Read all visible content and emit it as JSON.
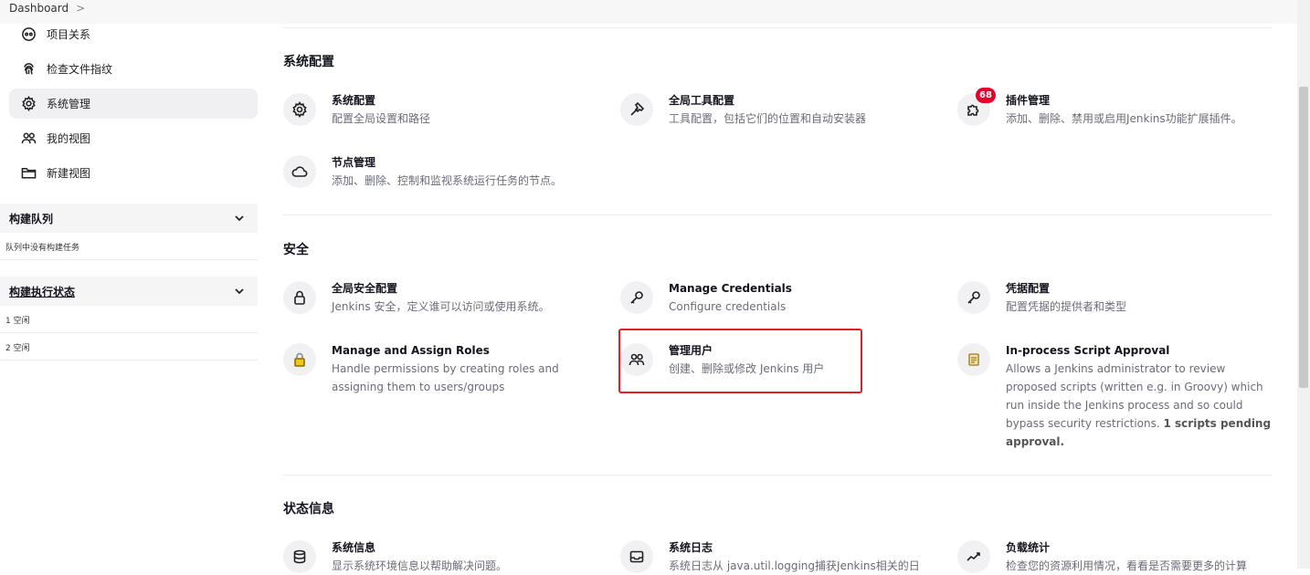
{
  "breadcrumb": {
    "home": "Dashboard",
    "separator": ">"
  },
  "sidebar": {
    "items": [
      {
        "label": "项目关系",
        "icon": "relationship-icon"
      },
      {
        "label": "检查文件指纹",
        "icon": "fingerprint-icon"
      },
      {
        "label": "系统管理",
        "icon": "gear-icon",
        "active": true
      },
      {
        "label": "我的视图",
        "icon": "people-icon"
      },
      {
        "label": "新建视图",
        "icon": "folder-icon"
      }
    ],
    "build_queue": {
      "title": "构建队列",
      "empty_text": "队列中没有构建任务"
    },
    "executors": {
      "title": "构建执行状态",
      "rows": [
        "1  空闲",
        "2  空闲"
      ]
    }
  },
  "sections": {
    "system_config": {
      "title": "系统配置",
      "cards": [
        {
          "title": "系统配置",
          "desc": "配置全局设置和路径",
          "icon": "gear-icon"
        },
        {
          "title": "全局工具配置",
          "desc": "工具配置，包括它们的位置和自动安装器",
          "icon": "hammer-icon"
        },
        {
          "title": "插件管理",
          "desc": "添加、删除、禁用或启用Jenkins功能扩展插件。",
          "icon": "puzzle-icon",
          "badge": "68"
        },
        {
          "title": "节点管理",
          "desc": "添加、删除、控制和监视系统运行任务的节点。",
          "icon": "cloud-icon"
        }
      ]
    },
    "security": {
      "title": "安全",
      "cards": [
        {
          "title": "全局安全配置",
          "desc": "Jenkins 安全，定义谁可以访问或使用系统。",
          "icon": "lock-icon"
        },
        {
          "title": "Manage Credentials",
          "desc": "Configure credentials",
          "icon": "key-icon"
        },
        {
          "title": "凭据配置",
          "desc": "配置凭据的提供者和类型",
          "icon": "key-icon"
        },
        {
          "title": "Manage and Assign Roles",
          "desc_line1": "Handle permissions by creating roles and",
          "desc_line2": "assigning them to users/groups",
          "icon": "padlock-yellow-icon"
        },
        {
          "title": "管理用户",
          "desc": "创建、删除或修改 Jenkins 用户",
          "icon": "users-icon"
        },
        {
          "title": "In-process Script Approval",
          "desc_lines": [
            "Allows a Jenkins administrator to review",
            "proposed scripts (written e.g. in Groovy) which",
            "run inside the Jenkins process and so could",
            "bypass security restrictions."
          ],
          "desc_bold_1": "1 scripts pending",
          "desc_bold_2": "approval.",
          "icon": "notepad-icon"
        }
      ]
    },
    "status": {
      "title": "状态信息",
      "cards": [
        {
          "title": "系统信息",
          "desc": "显示系统环境信息以帮助解决问题。",
          "icon": "database-icon"
        },
        {
          "title": "系统日志",
          "desc": "系统日志从 java.util.logging捕获Jenkins相关的日",
          "icon": "inbox-icon"
        },
        {
          "title": "负载统计",
          "desc": "检查您的资源利用情况，看看是否需要更多的计算",
          "icon": "trend-icon"
        }
      ]
    }
  },
  "colors": {
    "highlight": "#e21c2a",
    "badge": "#e6002b",
    "lock": "#f0c419"
  }
}
